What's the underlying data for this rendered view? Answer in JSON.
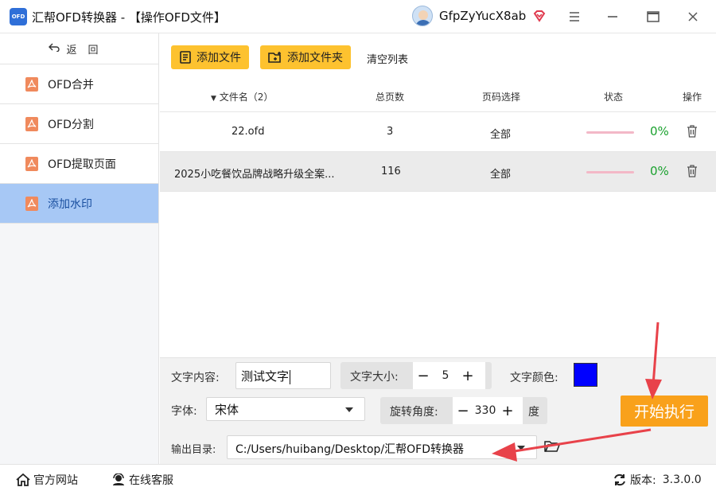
{
  "window": {
    "logo_text": "OFD",
    "title": "汇帮OFD转换器 - 【操作OFD文件】",
    "username": "GfpZyYucX8ab"
  },
  "sidebar": {
    "back_label": "返回",
    "items": [
      {
        "label": "OFD合并",
        "active": false
      },
      {
        "label": "OFD分割",
        "active": false
      },
      {
        "label": "OFD提取页面",
        "active": false
      },
      {
        "label": "添加水印",
        "active": true
      }
    ]
  },
  "toolbar": {
    "add_file": "添加文件",
    "add_folder": "添加文件夹",
    "clear_list": "清空列表"
  },
  "table": {
    "headers": {
      "filename": "文件名（2）",
      "pages": "总页数",
      "page_select": "页码选择",
      "status": "状态",
      "action": "操作"
    },
    "rows": [
      {
        "filename": "22.ofd",
        "pages": "3",
        "page_select": "全部",
        "progress": "0%"
      },
      {
        "filename": "2025小吃餐饮品牌战略升级全案...",
        "pages": "116",
        "page_select": "全部",
        "progress": "0%"
      }
    ]
  },
  "settings": {
    "text_content_label": "文字内容:",
    "text_content_value": "测试文字",
    "font_size_label": "文字大小:",
    "font_size_value": "5",
    "font_color_label": "文字颜色:",
    "font_color": "#0000ff",
    "font_label": "字体:",
    "font_value": "宋体",
    "rotation_label": "旋转角度:",
    "rotation_value": "330",
    "rotation_unit": "度",
    "output_label": "输出目录:",
    "output_value": "C:/Users/huibang/Desktop/汇帮OFD转换器",
    "start_button": "开始执行"
  },
  "statusbar": {
    "website": "官方网站",
    "support": "在线客服",
    "version_label": "版本:",
    "version_value": "3.3.0.0"
  },
  "colors": {
    "accent_yellow": "#fdc22f",
    "start_orange": "#f9a11b",
    "active_nav": "#a7c8f5",
    "progress_green": "#1aa12e",
    "annotation_red": "#e8424a"
  }
}
